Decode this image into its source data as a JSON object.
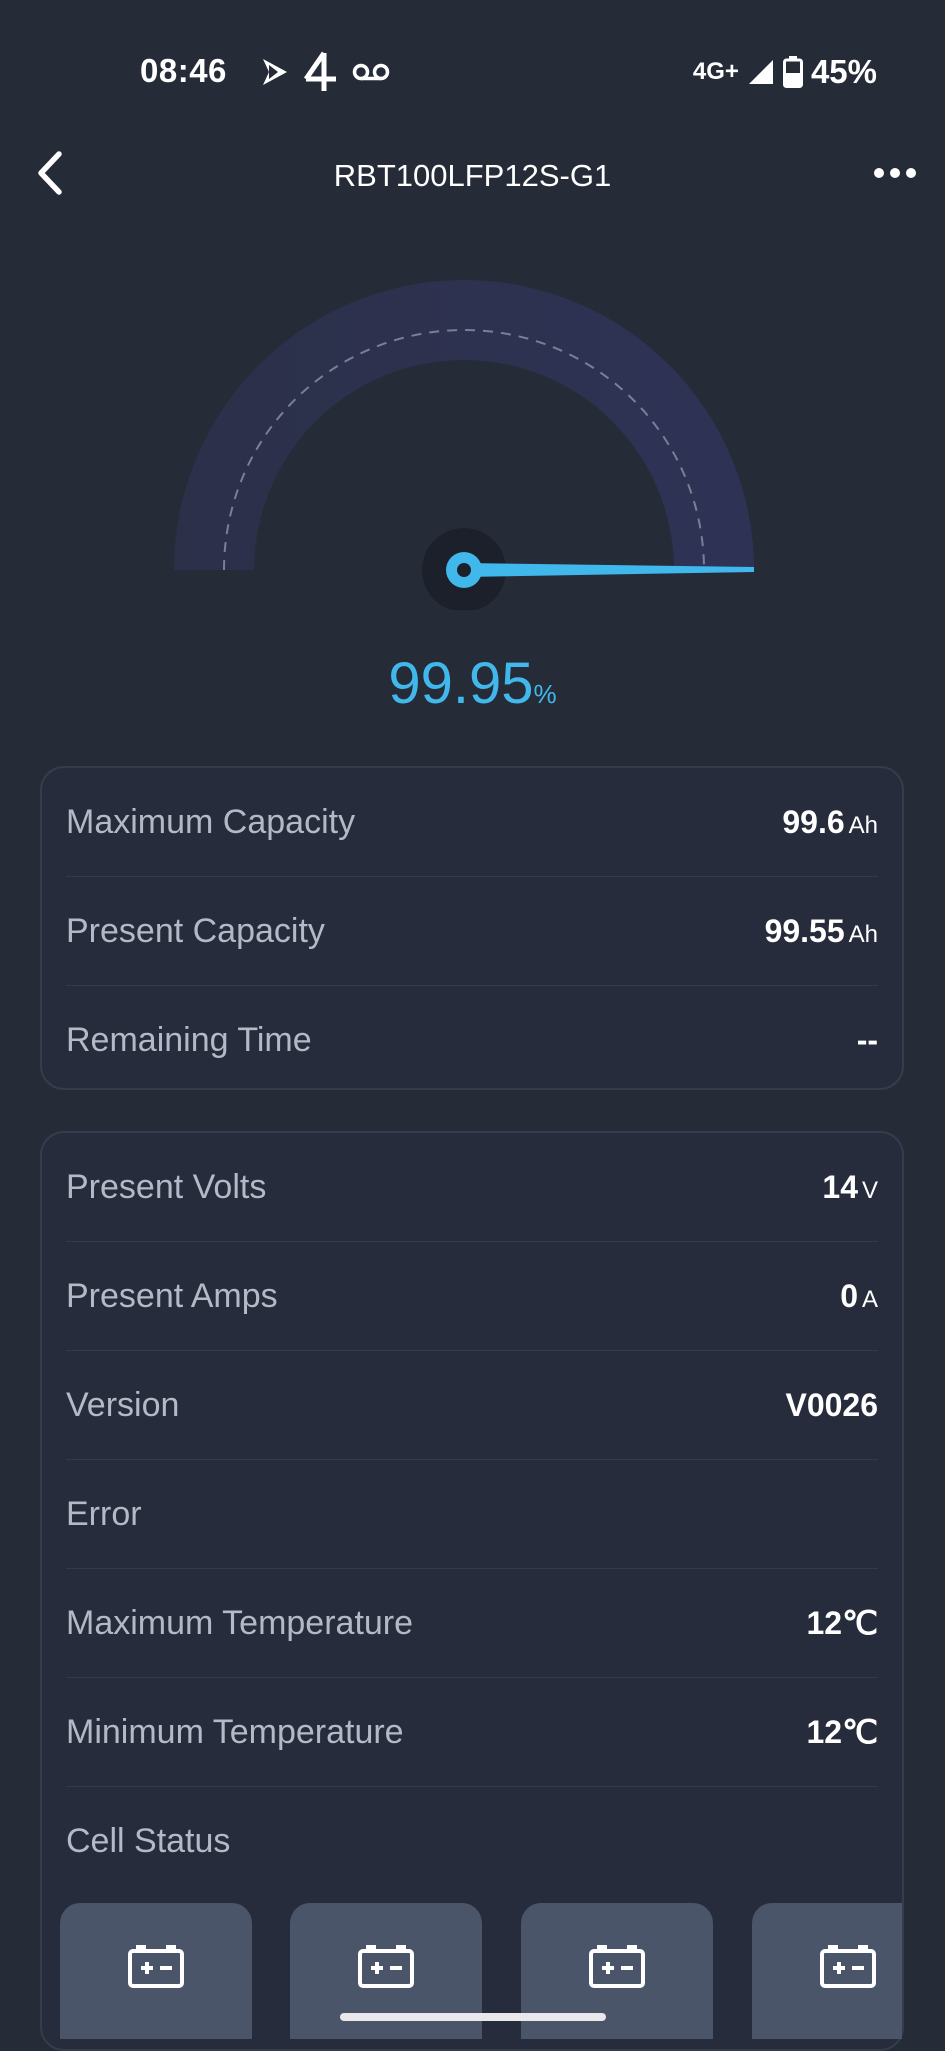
{
  "status_bar": {
    "time": "08:46",
    "network": "4G+",
    "battery": "45%",
    "icons": [
      "play-icon",
      "channel4-icon",
      "voicemail-icon",
      "signal-icon",
      "battery-icon"
    ]
  },
  "header": {
    "title": "RBT100LFP12S-G1",
    "back_icon": "chevron-left-icon",
    "more_icon": "more-dots-icon"
  },
  "gauge": {
    "value": "99.95",
    "unit": "%",
    "level": 0.9995,
    "colors": {
      "accent": "#41b8ec",
      "track": "#2d3250",
      "center": "#1c202b"
    }
  },
  "capacity": [
    {
      "label": "Maximum Capacity",
      "value": "99.6",
      "unit": "Ah"
    },
    {
      "label": "Present Capacity",
      "value": "99.55",
      "unit": "Ah"
    },
    {
      "label": "Remaining Time",
      "value": "--",
      "unit": ""
    }
  ],
  "details": [
    {
      "label": "Present Volts",
      "value": "14",
      "unit": "V"
    },
    {
      "label": "Present Amps",
      "value": "0",
      "unit": "A"
    },
    {
      "label": "Version",
      "value": "V0026",
      "unit": ""
    },
    {
      "label": "Error",
      "value": "",
      "unit": ""
    },
    {
      "label": "Maximum Temperature",
      "value": "12℃",
      "unit": ""
    },
    {
      "label": "Minimum Temperature",
      "value": "12℃",
      "unit": ""
    }
  ],
  "cell_status": {
    "label": "Cell Status",
    "cells": [
      "battery-cell-icon",
      "battery-cell-icon",
      "battery-cell-icon",
      "battery-cell-icon"
    ]
  }
}
